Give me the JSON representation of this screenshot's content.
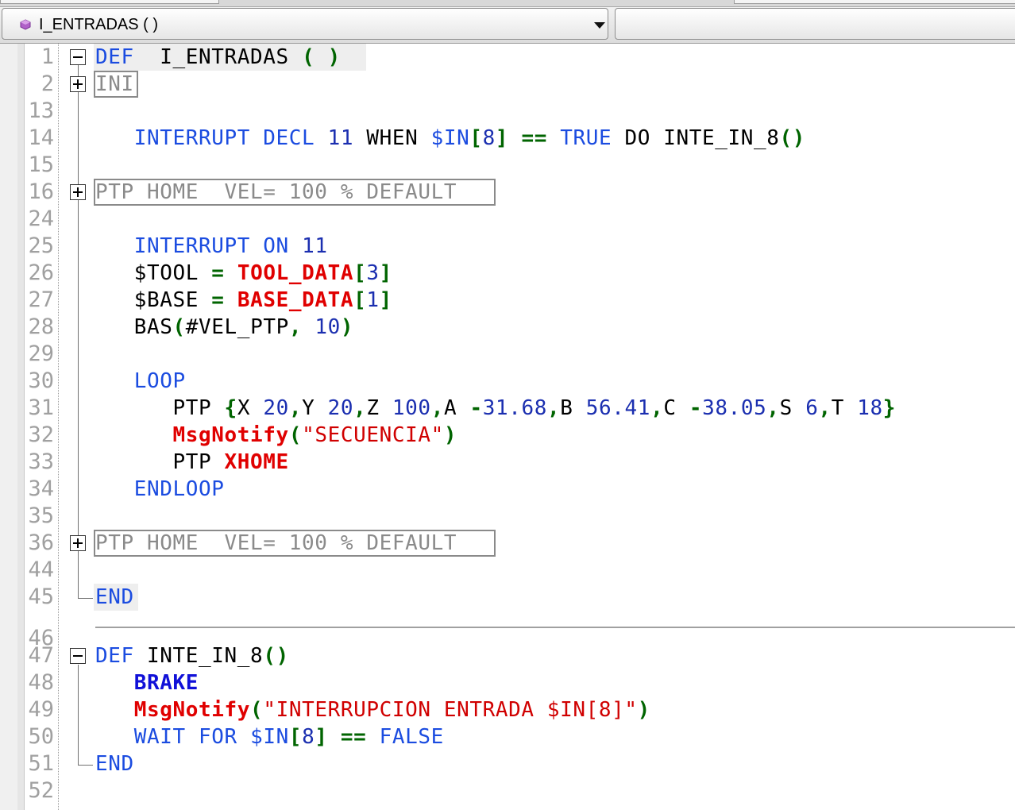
{
  "header": {
    "function_select": "I_ENTRADAS ( )"
  },
  "editor": {
    "lines": [
      {
        "n": "1",
        "tokens": [
          [
            "kw",
            "DEF"
          ],
          [
            "",
            "  I_ENTRADAS "
          ],
          [
            "grn",
            "( )"
          ]
        ]
      },
      {
        "n": "2",
        "tokens": [
          [
            "fold-grey",
            "INI"
          ]
        ]
      },
      {
        "n": "13",
        "tokens": []
      },
      {
        "n": "14",
        "tokens": [
          [
            "",
            "   "
          ],
          [
            "kw",
            "INTERRUPT DECL"
          ],
          [
            "",
            " "
          ],
          [
            "num",
            "11"
          ],
          [
            "",
            " WHEN "
          ],
          [
            "kw",
            "$IN"
          ],
          [
            "grn",
            "["
          ],
          [
            "num",
            "8"
          ],
          [
            "grn",
            "]"
          ],
          [
            "",
            " "
          ],
          [
            "grn",
            "=="
          ],
          [
            "",
            " "
          ],
          [
            "kw",
            "TRUE"
          ],
          [
            "",
            " DO INTE_IN_8"
          ],
          [
            "grn",
            "()"
          ]
        ]
      },
      {
        "n": "15",
        "tokens": []
      },
      {
        "n": "16",
        "tokens": [
          [
            "fold-grey",
            "PTP HOME  VEL= 100 % DEFAULT"
          ]
        ]
      },
      {
        "n": "24",
        "tokens": []
      },
      {
        "n": "25",
        "tokens": [
          [
            "",
            "   "
          ],
          [
            "kw",
            "INTERRUPT ON"
          ],
          [
            "",
            " "
          ],
          [
            "num",
            "11"
          ]
        ]
      },
      {
        "n": "26",
        "tokens": [
          [
            "",
            "   $TOOL "
          ],
          [
            "grn",
            "="
          ],
          [
            "",
            " "
          ],
          [
            "red",
            "TOOL_DATA"
          ],
          [
            "grn",
            "["
          ],
          [
            "num",
            "3"
          ],
          [
            "grn",
            "]"
          ]
        ]
      },
      {
        "n": "27",
        "tokens": [
          [
            "",
            "   $BASE "
          ],
          [
            "grn",
            "="
          ],
          [
            "",
            " "
          ],
          [
            "red",
            "BASE_DATA"
          ],
          [
            "grn",
            "["
          ],
          [
            "num",
            "1"
          ],
          [
            "grn",
            "]"
          ]
        ]
      },
      {
        "n": "28",
        "tokens": [
          [
            "",
            "   BAS"
          ],
          [
            "grn",
            "("
          ],
          [
            "",
            "#VEL_PTP"
          ],
          [
            "grn",
            ","
          ],
          [
            "",
            " "
          ],
          [
            "num",
            "10"
          ],
          [
            "grn",
            ")"
          ]
        ]
      },
      {
        "n": "29",
        "tokens": []
      },
      {
        "n": "30",
        "tokens": [
          [
            "",
            "   "
          ],
          [
            "kw",
            "LOOP"
          ]
        ]
      },
      {
        "n": "31",
        "tokens": [
          [
            "",
            "      PTP "
          ],
          [
            "grn",
            "{"
          ],
          [
            "",
            "X "
          ],
          [
            "num",
            "20"
          ],
          [
            "grn",
            ","
          ],
          [
            "",
            "Y "
          ],
          [
            "num",
            "20"
          ],
          [
            "grn",
            ","
          ],
          [
            "",
            "Z "
          ],
          [
            "num",
            "100"
          ],
          [
            "grn",
            ","
          ],
          [
            "",
            "A "
          ],
          [
            "grn",
            "-"
          ],
          [
            "num",
            "31.68"
          ],
          [
            "grn",
            ","
          ],
          [
            "",
            "B "
          ],
          [
            "num",
            "56.41"
          ],
          [
            "grn",
            ","
          ],
          [
            "",
            "C "
          ],
          [
            "grn",
            "-"
          ],
          [
            "num",
            "38.05"
          ],
          [
            "grn",
            ","
          ],
          [
            "",
            "S "
          ],
          [
            "num",
            "6"
          ],
          [
            "grn",
            ","
          ],
          [
            "",
            "T "
          ],
          [
            "num",
            "18"
          ],
          [
            "grn",
            "}"
          ]
        ]
      },
      {
        "n": "32",
        "tokens": [
          [
            "",
            "      "
          ],
          [
            "red",
            "MsgNotify"
          ],
          [
            "grn",
            "("
          ],
          [
            "str",
            "\"SECUENCIA\""
          ],
          [
            "grn",
            ")"
          ]
        ]
      },
      {
        "n": "33",
        "tokens": [
          [
            "",
            "      PTP "
          ],
          [
            "red",
            "XHOME"
          ]
        ]
      },
      {
        "n": "34",
        "tokens": [
          [
            "",
            "   "
          ],
          [
            "kw",
            "ENDLOOP"
          ]
        ]
      },
      {
        "n": "35",
        "tokens": []
      },
      {
        "n": "36",
        "tokens": [
          [
            "fold-grey",
            "PTP HOME  VEL= 100 % DEFAULT"
          ]
        ]
      },
      {
        "n": "44",
        "tokens": []
      },
      {
        "n": "45",
        "tokens": [
          [
            "kw",
            "END"
          ]
        ]
      },
      {
        "n": "46",
        "tokens": []
      },
      {
        "n": "47",
        "tokens": [
          [
            "kw",
            "DEF"
          ],
          [
            "",
            " INTE_IN_8"
          ],
          [
            "grn",
            "()"
          ]
        ]
      },
      {
        "n": "48",
        "tokens": [
          [
            "",
            "   "
          ],
          [
            "kwb",
            "BRAKE"
          ]
        ]
      },
      {
        "n": "49",
        "tokens": [
          [
            "",
            "   "
          ],
          [
            "red",
            "MsgNotify"
          ],
          [
            "grn",
            "("
          ],
          [
            "str",
            "\"INTERRUPCION ENTRADA $IN[8]\""
          ],
          [
            "grn",
            ")"
          ]
        ]
      },
      {
        "n": "50",
        "tokens": [
          [
            "",
            "   "
          ],
          [
            "kw",
            "WAIT FOR"
          ],
          [
            "",
            " "
          ],
          [
            "kw",
            "$IN"
          ],
          [
            "grn",
            "["
          ],
          [
            "num",
            "8"
          ],
          [
            "grn",
            "]"
          ],
          [
            "",
            " "
          ],
          [
            "grn",
            "=="
          ],
          [
            "",
            " "
          ],
          [
            "kw",
            "FALSE"
          ]
        ]
      },
      {
        "n": "51",
        "tokens": [
          [
            "kw",
            "END"
          ]
        ]
      },
      {
        "n": "52",
        "tokens": []
      }
    ]
  }
}
